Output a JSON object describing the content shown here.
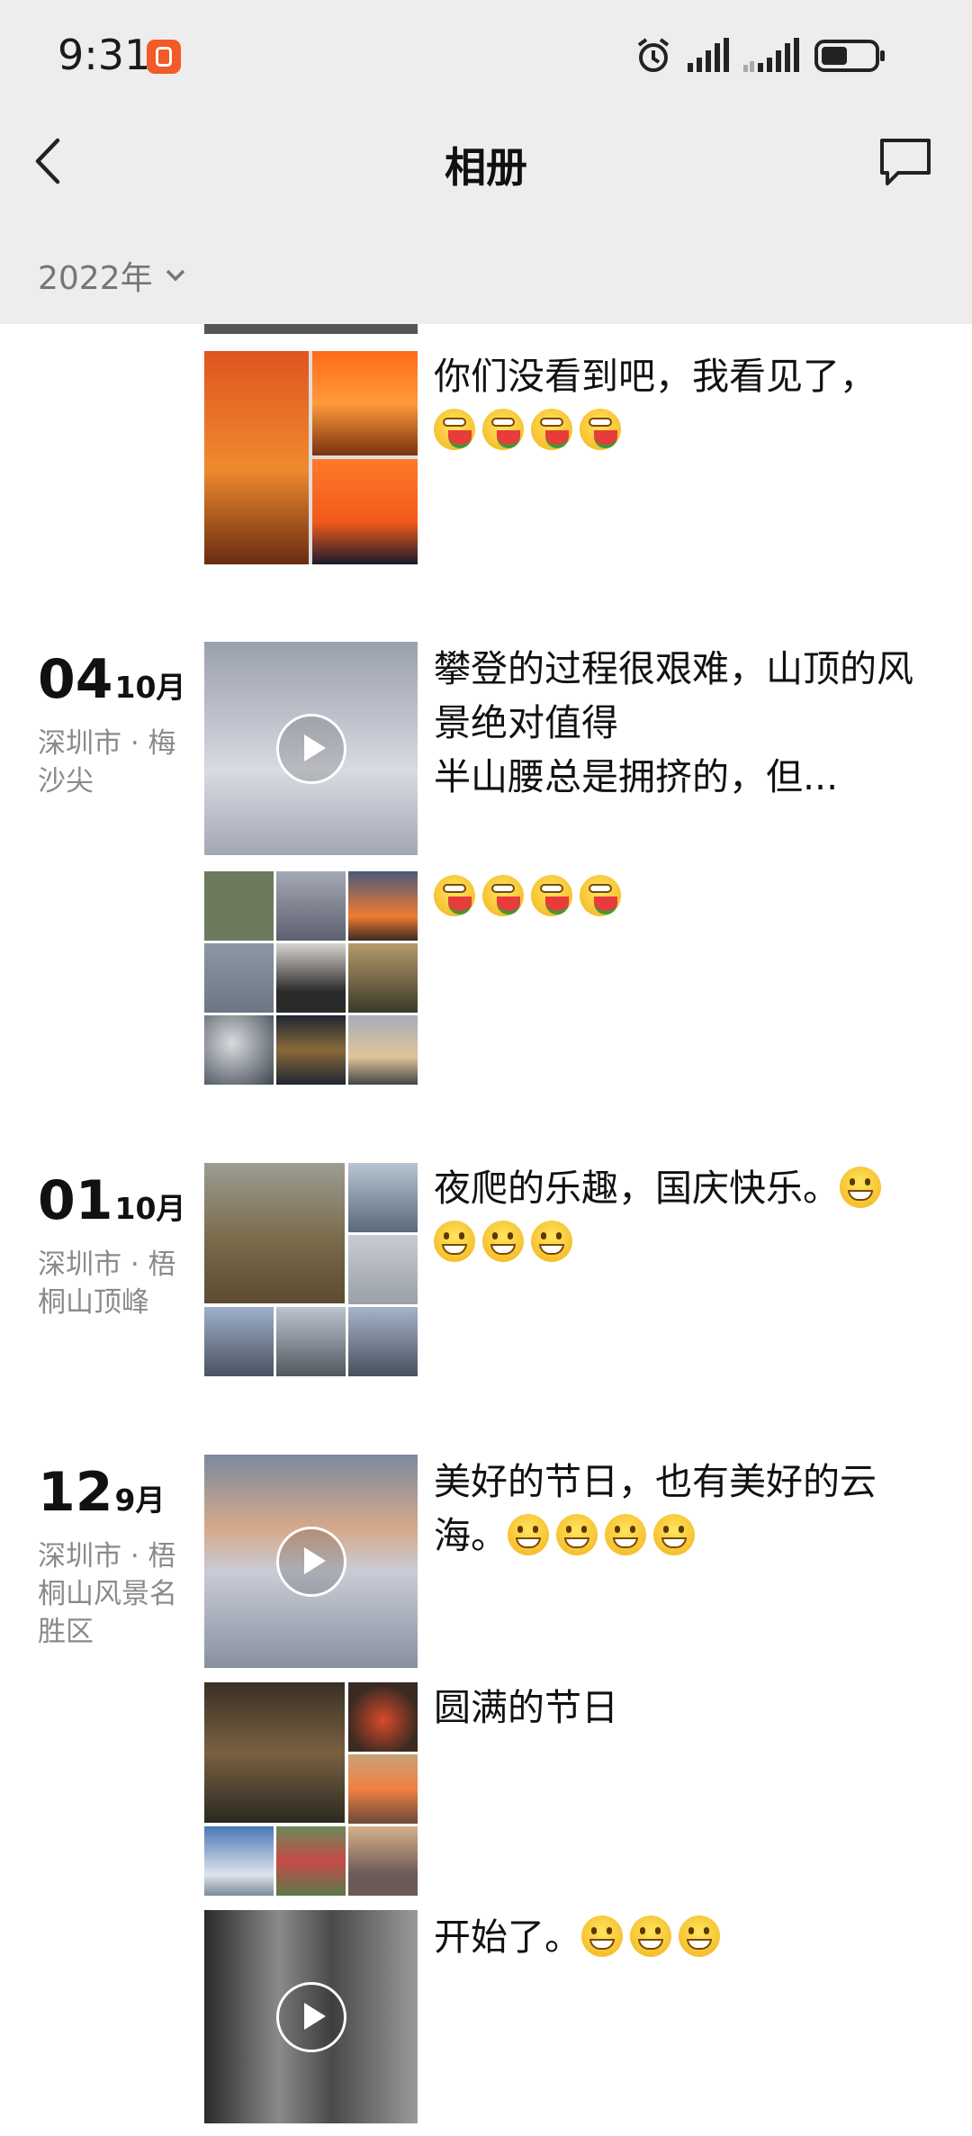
{
  "status_bar": {
    "time": "9:31"
  },
  "header": {
    "title": "相册",
    "year": "2022年"
  },
  "posts": [
    {
      "text": "你们没看到吧，我看见了，"
    },
    {
      "day": "04",
      "month": "10月",
      "location": "深圳市 · 梅沙尖",
      "text": "攀登的过程很艰难，山顶的风景绝对值得\n半山腰总是拥挤的，但..."
    },
    {
      "text": ""
    },
    {
      "day": "01",
      "month": "10月",
      "location": "深圳市 · 梧桐山顶峰",
      "text": "夜爬的乐趣，国庆快乐。"
    },
    {
      "day": "12",
      "month": "9月",
      "location": "深圳市 · 梧桐山风景名胜区",
      "text": "美好的节日，也有美好的云海。"
    },
    {
      "text": "圆满的节日"
    },
    {
      "text": "开始了。"
    }
  ],
  "colors": {
    "header_bg": "#ededed",
    "accent_badge": "#f25a28",
    "secondary_text": "#8a8a8a"
  },
  "icons": [
    "back-icon",
    "message-icon",
    "chevron-down-icon",
    "alarm-icon",
    "signal-icon",
    "battery-icon",
    "play-icon",
    "emoji-icon"
  ]
}
